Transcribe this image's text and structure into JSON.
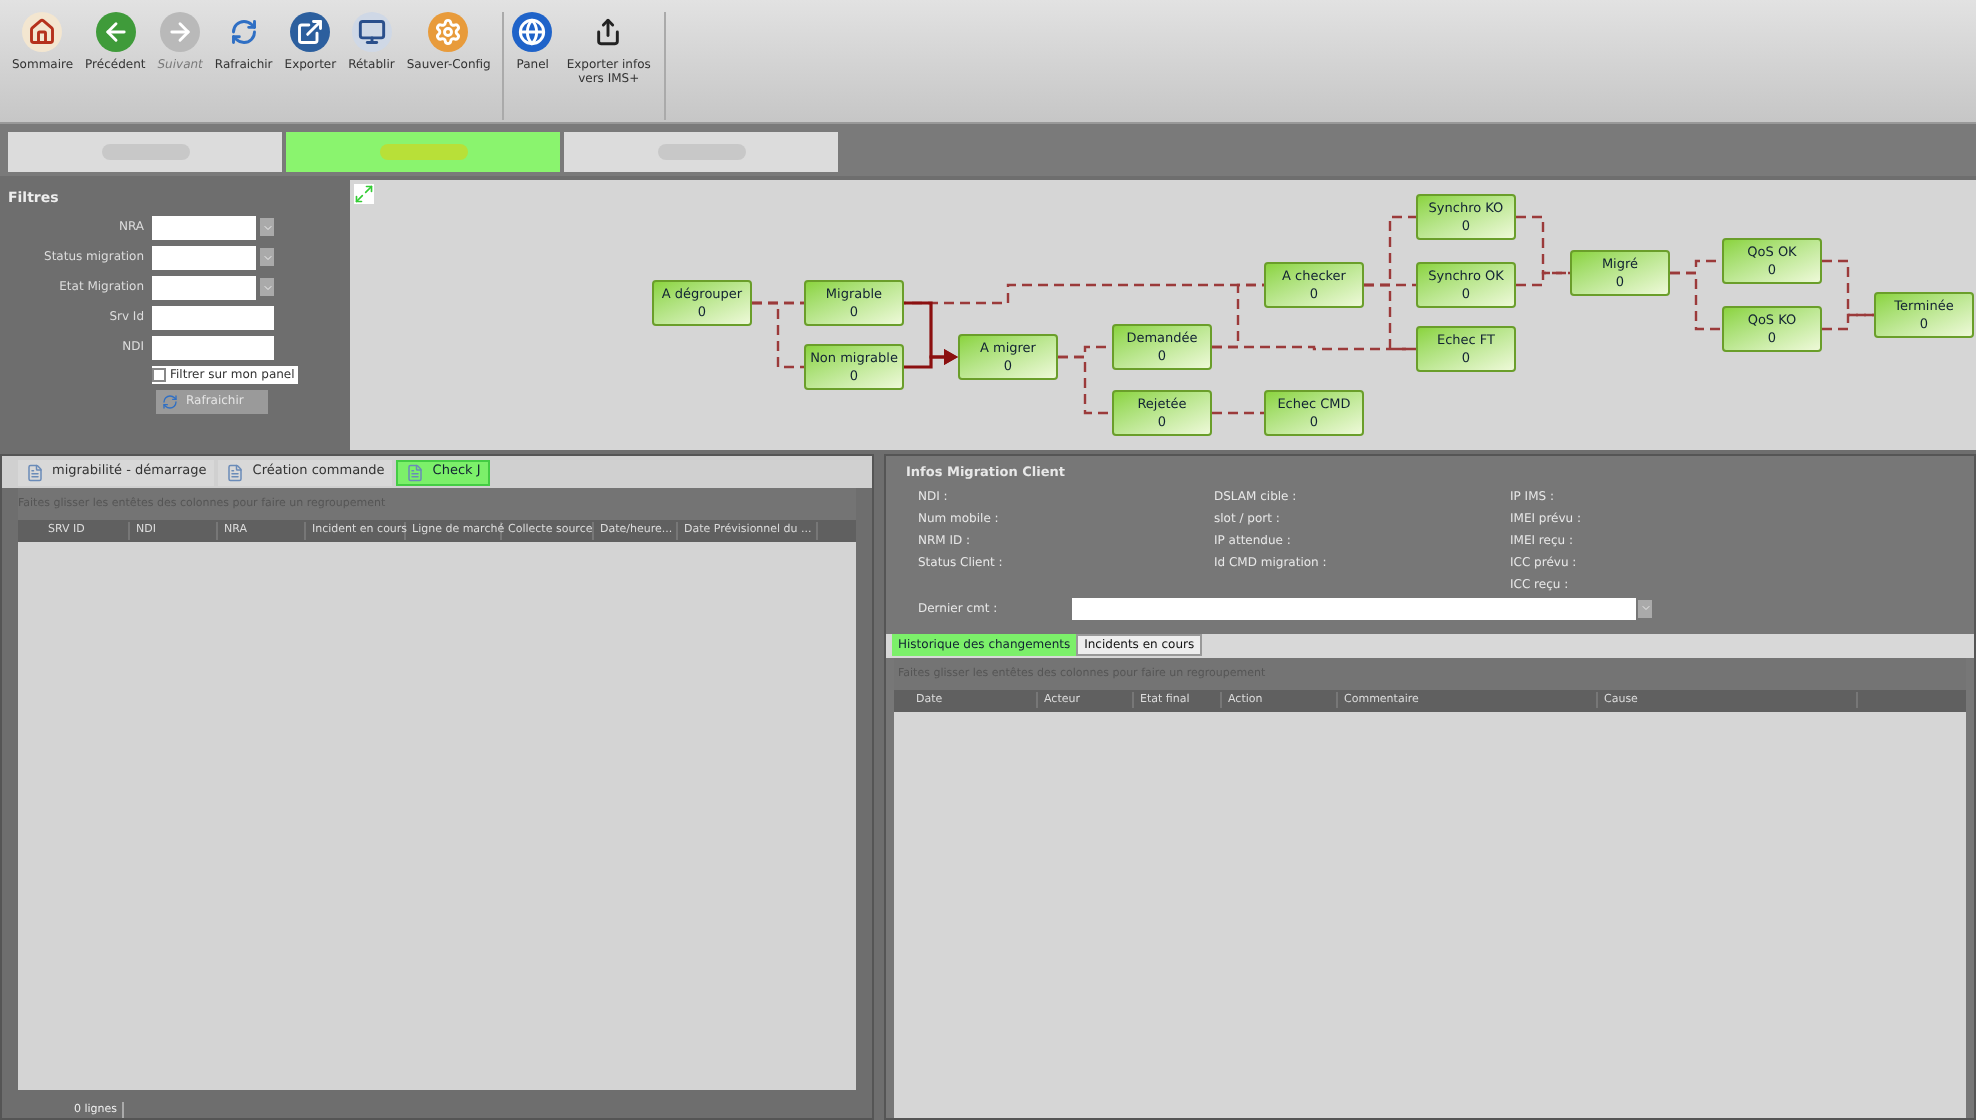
{
  "toolbar": {
    "groups": [
      [
        {
          "label": "Sommaire",
          "disabled": false
        },
        {
          "label": "Précédent",
          "disabled": false
        },
        {
          "label": "Suivant",
          "disabled": true
        },
        {
          "label": "Rafraichir",
          "disabled": false
        },
        {
          "label": "Exporter",
          "disabled": false
        },
        {
          "label": "Rétablir",
          "disabled": false
        },
        {
          "label": "Sauver-Config",
          "disabled": false
        }
      ],
      [
        {
          "label": "Panel",
          "disabled": false
        },
        {
          "label": "Exporter infos vers IMS+",
          "disabled": false
        }
      ]
    ]
  },
  "top_tabs": [
    {
      "selected": false
    },
    {
      "selected": true
    },
    {
      "selected": false
    }
  ],
  "filters": {
    "title": "Filtres",
    "fields": [
      {
        "label": "NRA",
        "kind": "dropdown"
      },
      {
        "label": "Status migration",
        "kind": "dropdown"
      },
      {
        "label": "Etat Migration",
        "kind": "dropdown"
      },
      {
        "label": "Srv Id",
        "kind": "text"
      },
      {
        "label": "NDI",
        "kind": "text"
      }
    ],
    "checkbox": {
      "label": "Filtrer sur mon panel",
      "checked": false
    },
    "button": "Rafraichir"
  },
  "workflow": {
    "nodes": [
      {
        "label": "A dégrouper",
        "count": "0"
      },
      {
        "label": "Migrable",
        "count": "0"
      },
      {
        "label": "Non migrable",
        "count": "0"
      },
      {
        "label": "A migrer",
        "count": "0"
      },
      {
        "label": "Demandée",
        "count": "0"
      },
      {
        "label": "Rejetée",
        "count": "0"
      },
      {
        "label": "A checker",
        "count": "0"
      },
      {
        "label": "Echec CMD",
        "count": "0"
      },
      {
        "label": "Synchro KO",
        "count": "0"
      },
      {
        "label": "Synchro OK",
        "count": "0"
      },
      {
        "label": "Echec FT",
        "count": "0"
      },
      {
        "label": "Migré",
        "count": "0"
      },
      {
        "label": "QoS OK",
        "count": "0"
      },
      {
        "label": "QoS KO",
        "count": "0"
      },
      {
        "label": "Terminée",
        "count": "0"
      }
    ]
  },
  "left_panel": {
    "tabs": [
      {
        "label": "migrabilité - démarrage",
        "selected": false
      },
      {
        "label": "Création commande",
        "selected": false
      },
      {
        "label": "Check J",
        "selected": true
      }
    ],
    "group_hint": "Faites glisser les entêtes des colonnes pour faire un regroupement",
    "columns": [
      "SRV ID",
      "NDI",
      "NRA",
      "Incident en cours",
      "Ligne de marché",
      "Collecte source",
      "Date/heure...",
      "Date Prévisionnel du ..."
    ],
    "row_count": "0 lignes"
  },
  "client_info": {
    "title": "Infos Migration Client",
    "columns": [
      [
        "NDI :",
        "Num mobile :",
        "NRM ID :",
        "Status Client :"
      ],
      [
        "DSLAM cible :",
        "slot / port :",
        "IP attendue :",
        "Id CMD migration :"
      ],
      [
        "IP IMS :",
        "IMEI prévu :",
        "IMEI reçu :",
        "ICC prévu :",
        "ICC reçu :"
      ]
    ],
    "last_comment_label": "Dernier cmt :"
  },
  "history": {
    "tabs": [
      {
        "label": "Historique des changements",
        "selected": true
      },
      {
        "label": "Incidents en cours",
        "selected": false
      }
    ],
    "group_hint": "Faites glisser les entêtes des colonnes pour faire un regroupement",
    "columns": [
      "Date",
      "Acteur",
      "Etat final",
      "Action",
      "Commentaire",
      "Cause"
    ]
  }
}
